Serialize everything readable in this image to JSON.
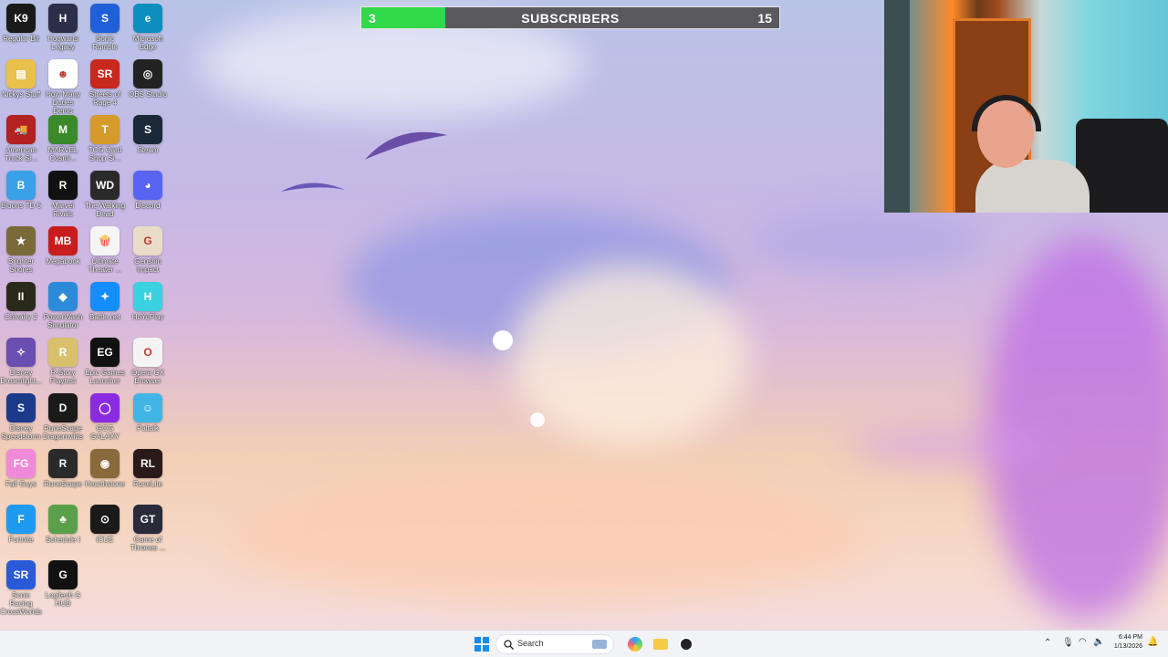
{
  "desktop_icons": [
    {
      "label": "Regular Bit",
      "glyph": "K9",
      "color": "#1a1a1a"
    },
    {
      "label": "Hogwarts Legacy",
      "glyph": "H",
      "color": "#2b2f4a"
    },
    {
      "label": "Sonic Rumble",
      "glyph": "S",
      "color": "#1f5fd8"
    },
    {
      "label": "Microsoft Edge",
      "glyph": "e",
      "color": "#0c8fbf"
    },
    {
      "label": "Nickys Stuff",
      "glyph": "▤",
      "color": "#e8c04a"
    },
    {
      "label": "How Many Dudes Demo",
      "glyph": "☻",
      "color": "#ffffff"
    },
    {
      "label": "Streets of Rage 4",
      "glyph": "SR",
      "color": "#c8281e"
    },
    {
      "label": "OBS Studio",
      "glyph": "◎",
      "color": "#222222"
    },
    {
      "label": "American Truck Si...",
      "glyph": "🚚",
      "color": "#b22222"
    },
    {
      "label": "MARVEL Cosmi...",
      "glyph": "M",
      "color": "#3a8a2a"
    },
    {
      "label": "TCG Card Shop Si...",
      "glyph": "T",
      "color": "#d69a2b"
    },
    {
      "label": "Steam",
      "glyph": "S",
      "color": "#1b2838"
    },
    {
      "label": "Bloons TD 6",
      "glyph": "B",
      "color": "#3aa0e8"
    },
    {
      "label": "Marvel Rivals",
      "glyph": "R",
      "color": "#111111"
    },
    {
      "label": "The Walking Dead",
      "glyph": "WD",
      "color": "#2a2a2a"
    },
    {
      "label": "Discord",
      "glyph": "◕",
      "color": "#5865f2"
    },
    {
      "label": "Brighter Shores",
      "glyph": "★",
      "color": "#7a6a3a"
    },
    {
      "label": "Megabonk",
      "glyph": "MB",
      "color": "#c81d1d"
    },
    {
      "label": "Ultimate Theater ...",
      "glyph": "🍿",
      "color": "#f5f5f5"
    },
    {
      "label": "Genshin Impact",
      "glyph": "G",
      "color": "#e9dcc8"
    },
    {
      "label": "Chivalry 2",
      "glyph": "II",
      "color": "#2a2a1a"
    },
    {
      "label": "PowerWash Simulator",
      "glyph": "◆",
      "color": "#2b8bd8"
    },
    {
      "label": "Battle.net",
      "glyph": "✦",
      "color": "#148eff"
    },
    {
      "label": "HoYoPlay",
      "glyph": "H",
      "color": "#3ad1e0"
    },
    {
      "label": "Disney Dreamlight...",
      "glyph": "✧",
      "color": "#6a4fb0"
    },
    {
      "label": "R-Story Playtest",
      "glyph": "R",
      "color": "#d8c16a"
    },
    {
      "label": "Epic Games Launcher",
      "glyph": "EG",
      "color": "#111111"
    },
    {
      "label": "Opera GX Browser",
      "glyph": "O",
      "color": "#f4f4f4"
    },
    {
      "label": "Disney Speedstorm",
      "glyph": "S",
      "color": "#1b3a8a"
    },
    {
      "label": "RuneScape Dragonwilds",
      "glyph": "D",
      "color": "#1a1a1a"
    },
    {
      "label": "GOG GALAXY",
      "glyph": "◯",
      "color": "#8a2be2"
    },
    {
      "label": "Paltalk",
      "glyph": "☺",
      "color": "#41b6e6"
    },
    {
      "label": "Fall Guys",
      "glyph": "FG",
      "color": "#f08ad8"
    },
    {
      "label": "RuneScape",
      "glyph": "R",
      "color": "#2a2a2a"
    },
    {
      "label": "Hearthstone",
      "glyph": "◉",
      "color": "#8a6a3a"
    },
    {
      "label": "RuneLite",
      "glyph": "RL",
      "color": "#2a1a1a"
    },
    {
      "label": "Fortnite",
      "glyph": "F",
      "color": "#1e9bf0"
    },
    {
      "label": "Schedule I",
      "glyph": "♣",
      "color": "#5aa04a"
    },
    {
      "label": "iCUE",
      "glyph": "⊙",
      "color": "#1a1a1a"
    },
    {
      "label": "Game of Thrones ...",
      "glyph": "GT",
      "color": "#2a2a3a"
    },
    {
      "label": "Sonic Racing CrossWorlds",
      "glyph": "SR",
      "color": "#2a5ad8"
    },
    {
      "label": "Logitech G HUB",
      "glyph": "G",
      "color": "#111111"
    }
  ],
  "subscriber_bar": {
    "current": "3",
    "title": "SUBSCRIBERS",
    "goal": "15",
    "progress_fraction": 0.2,
    "fill_color": "#30d84a"
  },
  "webcam": {
    "label": "webcam feed"
  },
  "taskbar": {
    "search_placeholder": "Search",
    "pinned": [
      {
        "name": "start-icon"
      },
      {
        "name": "search-icon"
      },
      {
        "name": "widget-icon"
      },
      {
        "name": "copilot-icon"
      },
      {
        "name": "file-explorer-icon"
      },
      {
        "name": "obs-icon"
      }
    ],
    "time": "6:44 PM",
    "date": "1/13/2026"
  }
}
